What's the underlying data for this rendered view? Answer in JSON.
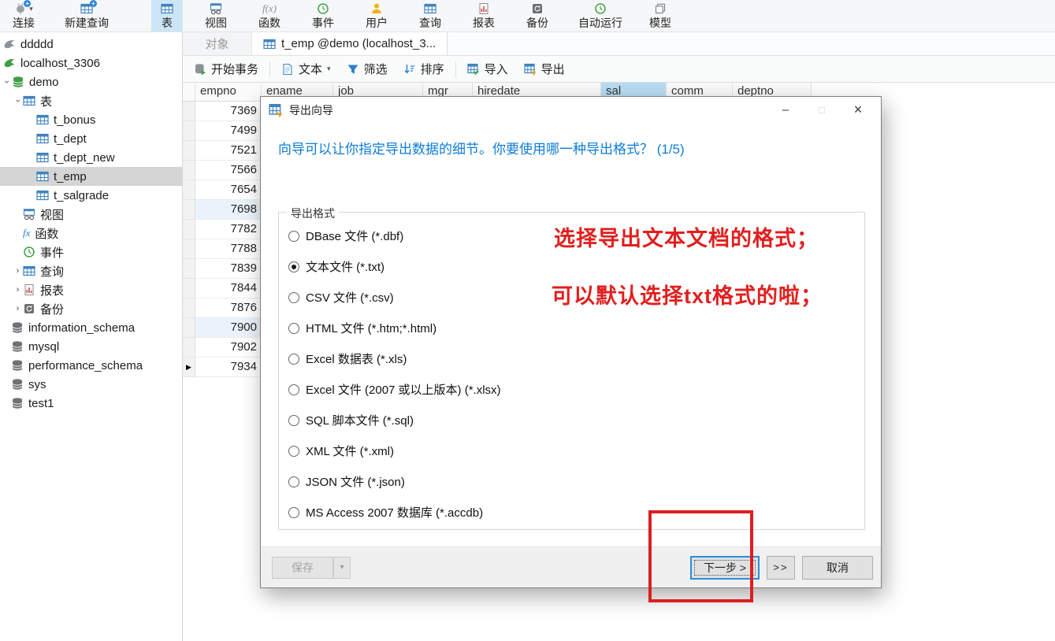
{
  "icons": {
    "caret_right": "›",
    "dropdown": "▾",
    "minimize": "–",
    "maximize": "□",
    "close": "×",
    "current_row_marker": "▶",
    "fx": "f(x)"
  },
  "main_toolbar": {
    "items": [
      {
        "label": "连接",
        "icon": "connection-icon",
        "has_caret": true,
        "active": false
      },
      {
        "label": "新建查询",
        "icon": "new-query-icon",
        "active": false
      },
      {
        "label": "表",
        "icon": "table-icon",
        "active": true
      },
      {
        "label": "视图",
        "icon": "view-icon",
        "active": false
      },
      {
        "label": "函数",
        "icon": "function-icon",
        "active": false
      },
      {
        "label": "事件",
        "icon": "event-icon",
        "active": false
      },
      {
        "label": "用户",
        "icon": "user-icon",
        "active": false
      },
      {
        "label": "查询",
        "icon": "query-icon",
        "active": false
      },
      {
        "label": "报表",
        "icon": "report-icon",
        "active": false
      },
      {
        "label": "备份",
        "icon": "backup-icon",
        "active": false
      },
      {
        "label": "自动运行",
        "icon": "automation-icon",
        "active": false
      },
      {
        "label": "模型",
        "icon": "model-icon",
        "active": false
      }
    ]
  },
  "sidebar": {
    "items": [
      {
        "label": "ddddd",
        "icon": "dolphin-gray-icon",
        "selected": false
      },
      {
        "label": "localhost_3306",
        "icon": "dolphin-green-icon",
        "selected": false
      },
      {
        "label": "demo",
        "icon": "database-green-icon",
        "expanded": true,
        "selected": false
      },
      {
        "label": "表",
        "icon": "table-icon",
        "expanded": true,
        "selected": false
      },
      {
        "label": "t_bonus",
        "icon": "table-icon",
        "selected": false
      },
      {
        "label": "t_dept",
        "icon": "table-icon",
        "selected": false
      },
      {
        "label": "t_dept_new",
        "icon": "table-icon",
        "selected": false
      },
      {
        "label": "t_emp",
        "icon": "table-icon",
        "selected": true
      },
      {
        "label": "t_salgrade",
        "icon": "table-icon",
        "selected": false
      },
      {
        "label": "视图",
        "icon": "view-icon",
        "selected": false
      },
      {
        "label": "函数",
        "icon": "function-icon",
        "selected": false
      },
      {
        "label": "事件",
        "icon": "event-icon",
        "selected": false
      },
      {
        "label": "查询",
        "icon": "query-icon",
        "collapsed": true,
        "selected": false
      },
      {
        "label": "报表",
        "icon": "report-icon",
        "collapsed": true,
        "selected": false
      },
      {
        "label": "备份",
        "icon": "backup-icon",
        "collapsed": true,
        "selected": false
      },
      {
        "label": "information_schema",
        "icon": "database-gray-icon",
        "selected": false
      },
      {
        "label": "mysql",
        "icon": "database-gray-icon",
        "selected": false
      },
      {
        "label": "performance_schema",
        "icon": "database-gray-icon",
        "selected": false
      },
      {
        "label": "sys",
        "icon": "database-gray-icon",
        "selected": false
      },
      {
        "label": "test1",
        "icon": "database-gray-icon",
        "selected": false
      }
    ]
  },
  "tab_bar": {
    "tabs": [
      {
        "label": "对象",
        "active": false
      },
      {
        "label": "t_emp @demo (localhost_3...",
        "active": true,
        "icon": "table-icon"
      }
    ]
  },
  "table_toolbar": {
    "items": [
      {
        "label": "开始事务",
        "icon": "begin-transaction-icon"
      },
      {
        "label": "文本",
        "icon": "text-icon",
        "has_caret": true
      },
      {
        "label": "筛选",
        "icon": "filter-icon"
      },
      {
        "label": "排序",
        "icon": "sort-icon"
      },
      {
        "label": "导入",
        "icon": "import-icon"
      },
      {
        "label": "导出",
        "icon": "export-icon"
      }
    ]
  },
  "grid": {
    "columns": [
      {
        "name": "empno"
      },
      {
        "name": "ename"
      },
      {
        "name": "job"
      },
      {
        "name": "mgr"
      },
      {
        "name": "hiredate"
      },
      {
        "name": "sal",
        "highlighted": true
      },
      {
        "name": "comm"
      },
      {
        "name": "deptno"
      }
    ],
    "rows": [
      {
        "v": "7369"
      },
      {
        "v": "7499"
      },
      {
        "v": "7521"
      },
      {
        "v": "7566"
      },
      {
        "v": "7654"
      },
      {
        "v": "7698",
        "highlighted": true
      },
      {
        "v": "7782"
      },
      {
        "v": "7788"
      },
      {
        "v": "7839"
      },
      {
        "v": "7844"
      },
      {
        "v": "7876"
      },
      {
        "v": "7900",
        "highlighted": true
      },
      {
        "v": "7902"
      },
      {
        "v": "7934",
        "current": true
      }
    ]
  },
  "dialog": {
    "title": "导出向导",
    "heading": "向导可以让你指定导出数据的细节。你要使用哪一种导出格式？ (1/5)",
    "group_label": "导出格式",
    "formats": [
      {
        "label": "DBase 文件 (*.dbf)",
        "selected": false
      },
      {
        "label": "文本文件 (*.txt)",
        "selected": true
      },
      {
        "label": "CSV 文件 (*.csv)",
        "selected": false
      },
      {
        "label": "HTML 文件 (*.htm;*.html)",
        "selected": false
      },
      {
        "label": "Excel 数据表 (*.xls)",
        "selected": false
      },
      {
        "label": "Excel 文件 (2007 或以上版本) (*.xlsx)",
        "selected": false
      },
      {
        "label": "SQL 脚本文件 (*.sql)",
        "selected": false
      },
      {
        "label": "XML 文件 (*.xml)",
        "selected": false
      },
      {
        "label": "JSON 文件 (*.json)",
        "selected": false
      },
      {
        "label": "MS Access 2007 数据库 (*.accdb)",
        "selected": false
      }
    ],
    "buttons": {
      "save": "保存",
      "next": "下一步 >",
      "skip": ">>",
      "cancel": "取消"
    }
  },
  "annotations": {
    "line1": "选择导出文本文档的格式；",
    "line2": "可以默认选择txt格式的啦；",
    "box_color": "#db1f1f"
  }
}
